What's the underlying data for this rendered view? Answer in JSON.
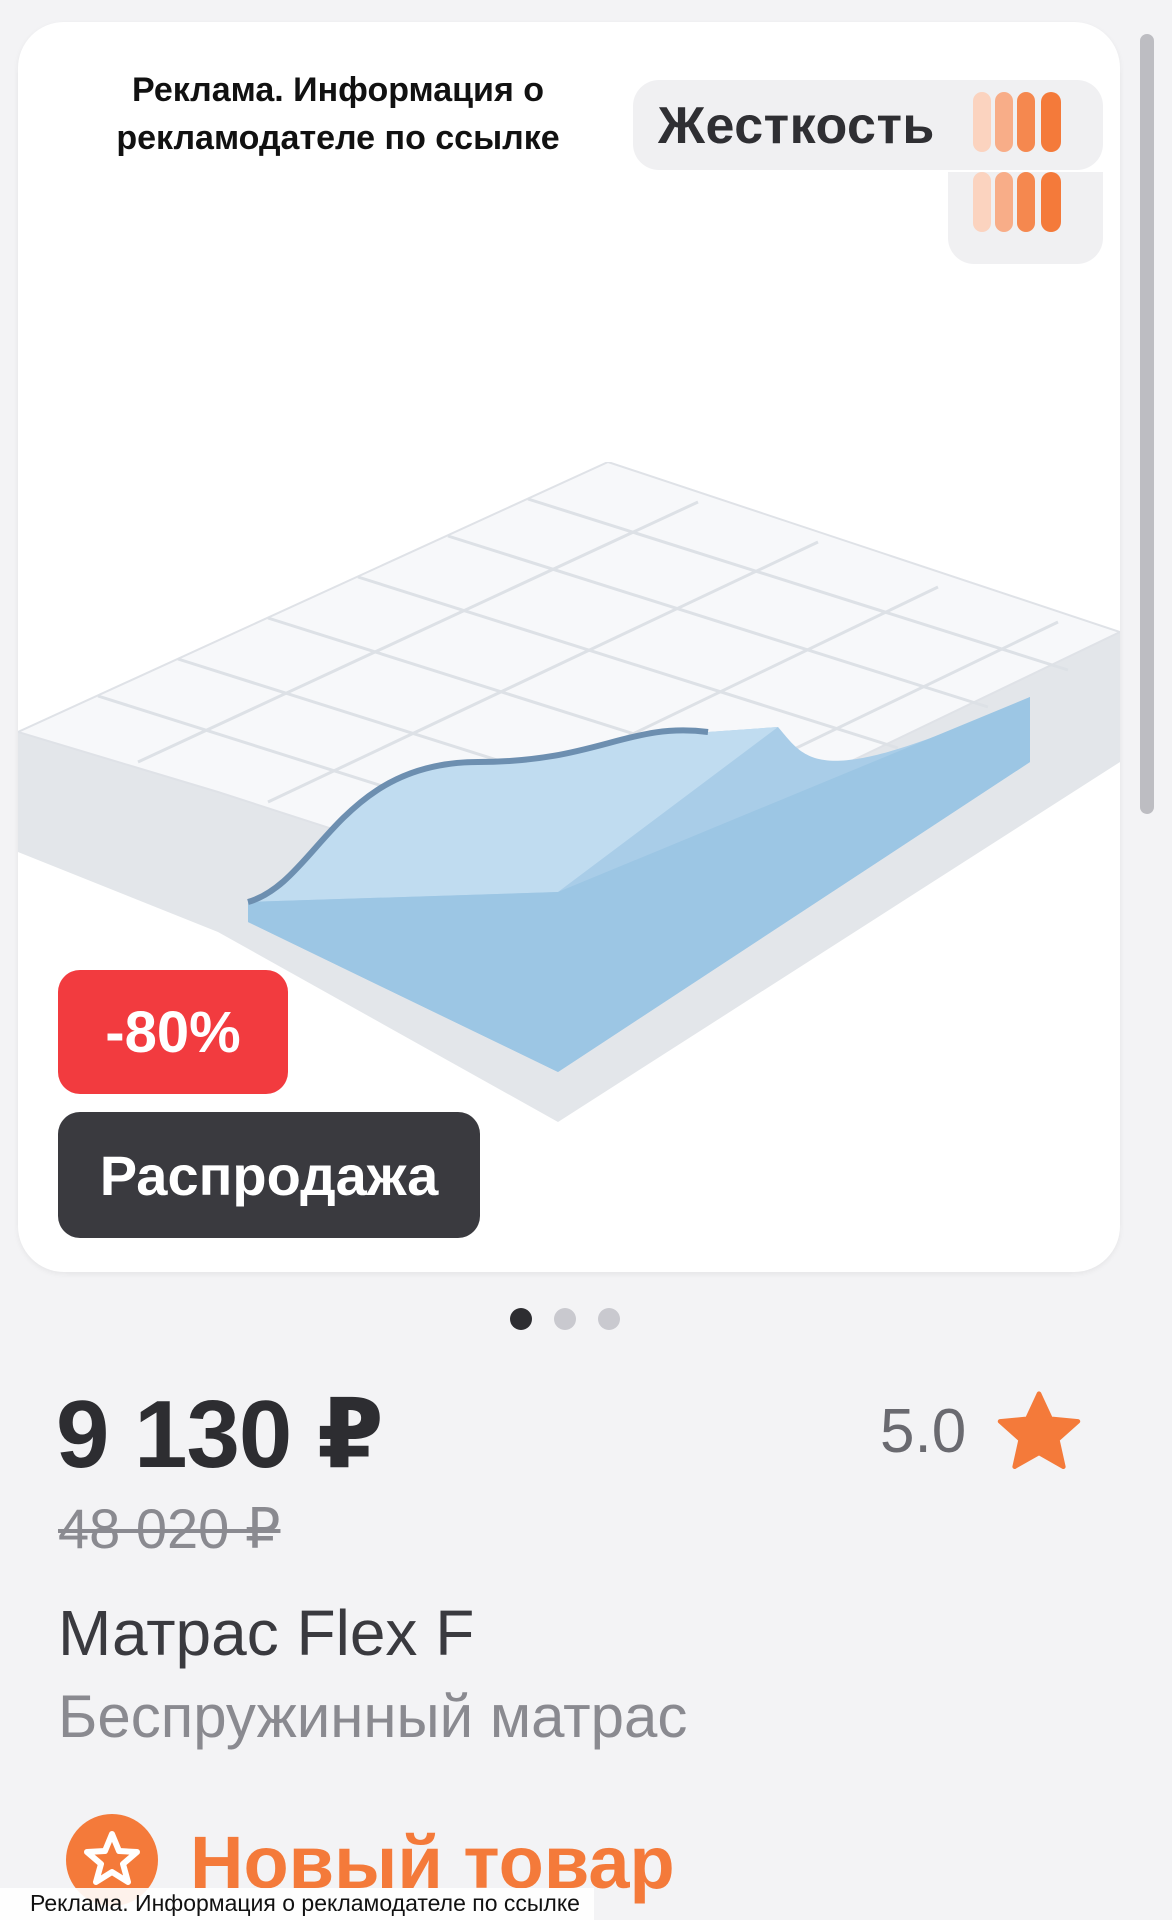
{
  "ad": {
    "label": "Реклама. Информация о рекламодателе по ссылке",
    "footer_note": "Реклама. Информация о рекламодателе по ссылке"
  },
  "firmness": {
    "label": "Жесткость",
    "icon": "firmness-bars-icon",
    "color": "#f47a3a"
  },
  "badges": {
    "discount": "-80%",
    "sale": "Распродажа",
    "discount_color": "#f23b3f",
    "sale_color": "#3a3a3f"
  },
  "gallery": {
    "dots_count": 3,
    "active_index": 0
  },
  "product": {
    "price": "9 130 ₽",
    "old_price": "48 020 ₽",
    "rating": "5.0",
    "rating_icon": "star-icon",
    "rating_color": "#f47a3a",
    "title": "Матрас Flex F",
    "subtitle": "Беспружинный матрас",
    "new_label": "Новый товар",
    "new_icon": "star-badge-icon"
  }
}
